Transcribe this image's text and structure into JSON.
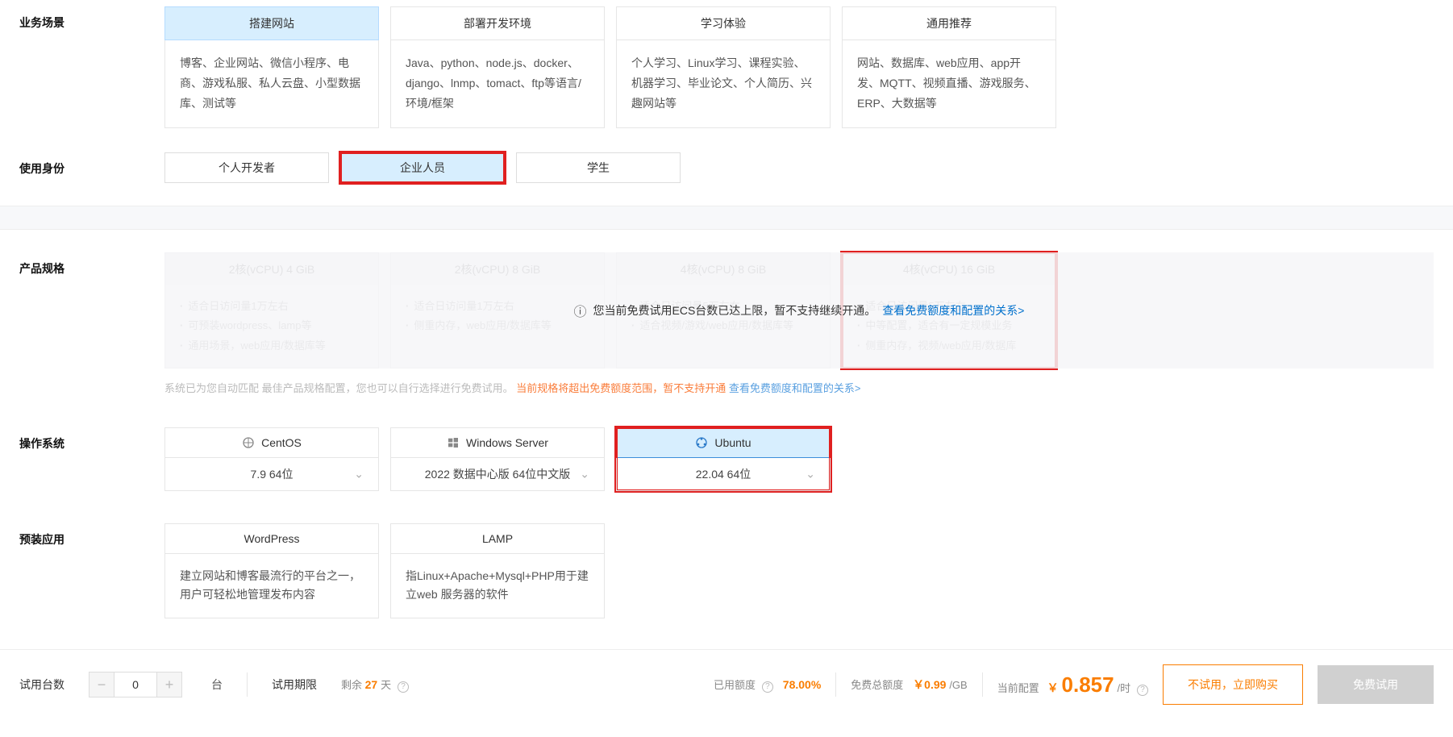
{
  "labels": {
    "scenario": "业务场景",
    "identity": "使用身份",
    "spec": "产品规格",
    "os": "操作系统",
    "preinstall": "预装应用"
  },
  "scenarios": {
    "site": {
      "title": "搭建网站",
      "desc": "博客、企业网站、微信小程序、电商、游戏私服、私人云盘、小型数据库、测试等"
    },
    "dev": {
      "title": "部署开发环境",
      "desc": "Java、python、node.js、docker、django、lnmp、tomact、ftp等语言/环境/框架"
    },
    "learn": {
      "title": "学习体验",
      "desc": "个人学习、Linux学习、课程实验、机器学习、毕业论文、个人简历、兴趣网站等"
    },
    "general": {
      "title": "通用推荐",
      "desc": "网站、数据库、web应用、app开发、MQTT、视频直播、游戏服务、ERP、大数据等"
    }
  },
  "identity": {
    "personal": "个人开发者",
    "enterprise": "企业人员",
    "student": "学生"
  },
  "specs": {
    "a": {
      "name": "2核(vCPU) 4 GiB",
      "p1": "适合日访问量1万左右",
      "p2": "可预装wordpress、lamp等",
      "p3": "通用场景，web应用/数据库等"
    },
    "b": {
      "name": "2核(vCPU) 8 GiB",
      "p1": "适合日访问量1万左右",
      "p2": "侧重内存，web应用/数据库等"
    },
    "c": {
      "name": "4核(vCPU) 8 GiB",
      "p1": "适合日访问量5万左右",
      "p2": "适合视频/游戏/web应用/数据库等"
    },
    "d": {
      "name": "4核(vCPU) 16 GiB",
      "p1": "适合日访问量5万左右",
      "p2": "中等配置，适合有一定规模业务",
      "p3": "侧重内存，视频/web应用/数据库"
    }
  },
  "overlay": {
    "msg": "您当前免费试用ECS台数已达上限，暂不支持继续开通。",
    "link": "查看免费额度和配置的关系>"
  },
  "hint": {
    "a": "系统已为您自动匹配 最佳产品规格配置，您也可以自行选择进行免费试用。",
    "b": "当前规格将超出免费额度范围，暂不支持开通 ",
    "c": "查看免费额度和配置的关系>"
  },
  "os": {
    "centos": {
      "name": "CentOS",
      "ver": "7.9 64位"
    },
    "win": {
      "name": "Windows Server",
      "ver": "2022 数据中心版 64位中文版"
    },
    "ubuntu": {
      "name": "Ubuntu",
      "ver": "22.04 64位"
    }
  },
  "apps": {
    "wp": {
      "name": "WordPress",
      "desc": "建立网站和博客最流行的平台之一，用户可轻松地管理发布内容"
    },
    "lamp": {
      "name": "LAMP",
      "desc": "指Linux+Apache+Mysql+PHP用于建立web 服务器的软件"
    }
  },
  "footer": {
    "trialCount": "试用台数",
    "countVal": "0",
    "unit": "台",
    "period": "试用期限",
    "remain1": "剩余 ",
    "remain2": "27",
    "remain3": " 天",
    "used": "已用额度",
    "usedPct": "78.00%",
    "total": "免费总额度",
    "totalPrice": "￥0.99",
    "totalUnit": "/GB",
    "current": "当前配置",
    "yen": "￥",
    "price": "0.857",
    "priceUnit": "/时",
    "buy": "不试用，立即购买",
    "free": "免费试用"
  }
}
